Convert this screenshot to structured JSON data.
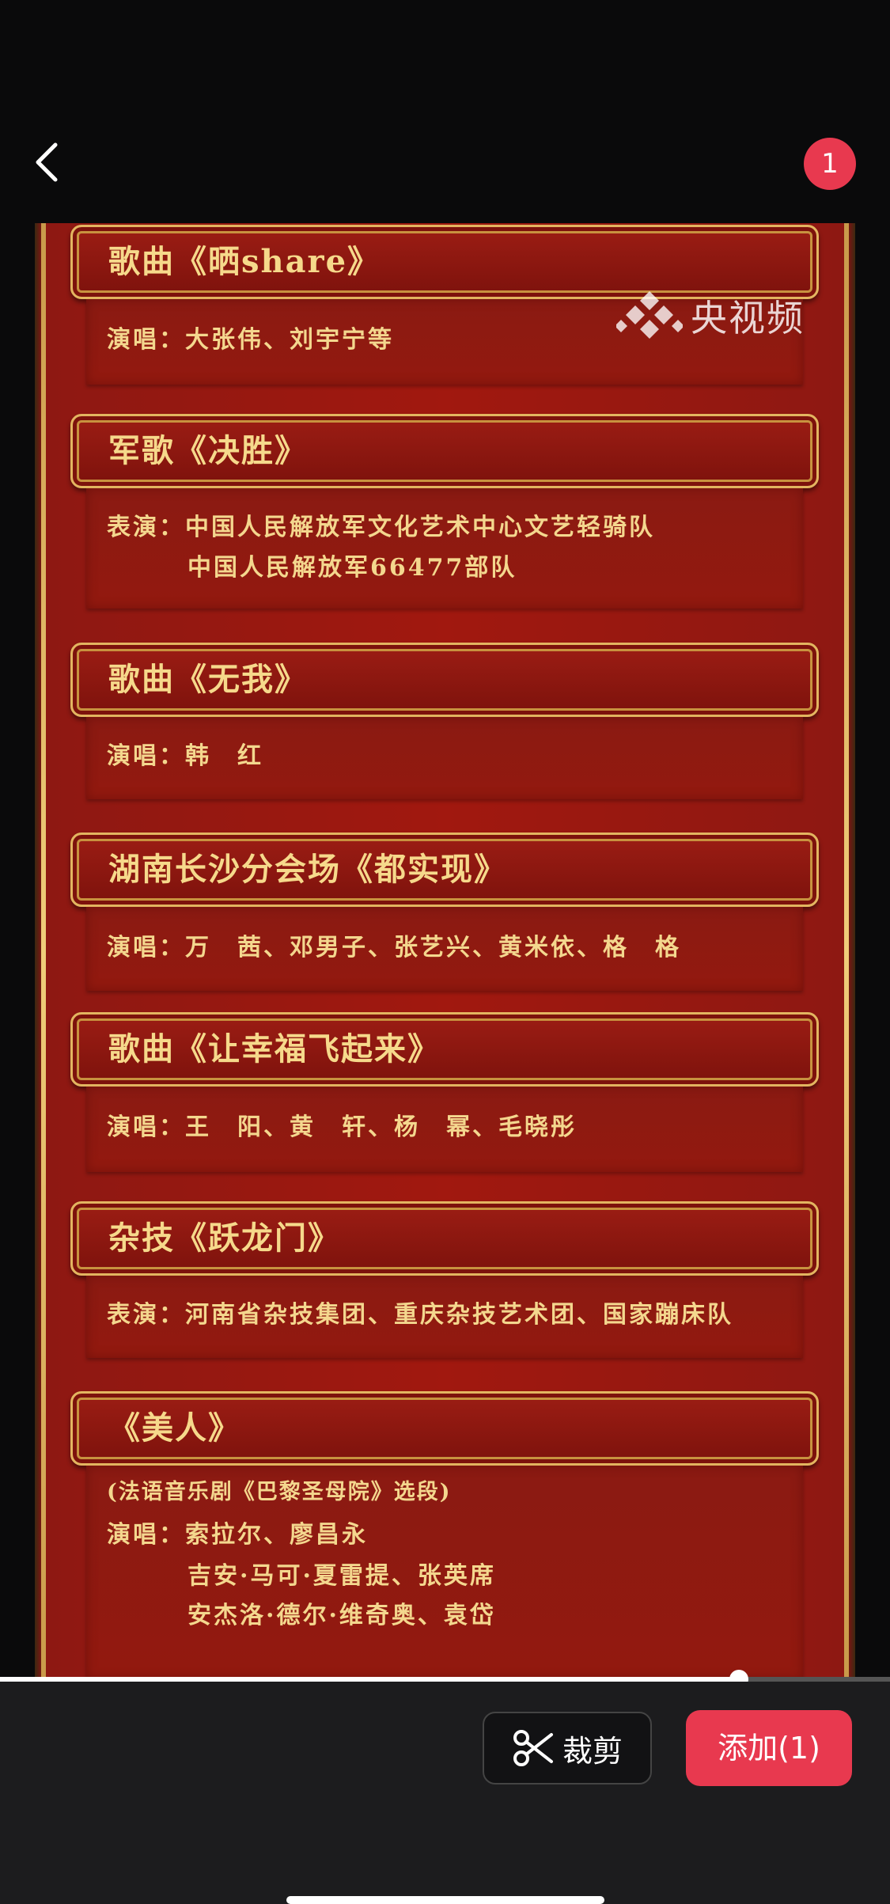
{
  "header": {
    "back_icon": "chevron-left-icon",
    "selection_count": "1"
  },
  "poster": {
    "watermark": "央视频",
    "sections": [
      {
        "title": "歌曲《晒share》",
        "lines": [
          "演唱：大张伟、刘宇宁等"
        ]
      },
      {
        "title": "军歌《决胜》",
        "lines": [
          "表演：中国人民解放军文化艺术中心文艺轻骑队",
          "中国人民解放军66477部队"
        ]
      },
      {
        "title": "歌曲《无我》",
        "lines": [
          "演唱：韩　红"
        ]
      },
      {
        "title": "湖南长沙分会场《都实现》",
        "lines": [
          "演唱：万　茜、邓男子、张艺兴、黄米依、格　格"
        ]
      },
      {
        "title": "歌曲《让幸福飞起来》",
        "lines": [
          "演唱：王　阳、黄　轩、杨　幂、毛晓彤"
        ]
      },
      {
        "title": "杂技《跃龙门》",
        "lines": [
          "表演：河南省杂技集团、重庆杂技艺术团、国家蹦床队"
        ]
      },
      {
        "title": "《美人》",
        "lines": [
          "(法语音乐剧《巴黎圣母院》选段)",
          "演唱：索拉尔、廖昌永",
          "吉安·马可·夏雷提、张英席",
          "安杰洛·德尔·维奇奥、袁岱"
        ]
      }
    ]
  },
  "progress": {
    "value_percent": 83
  },
  "toolbar": {
    "crop_label": "裁剪",
    "crop_icon": "scissors-icon",
    "add_label": "添加(1)"
  },
  "colors": {
    "accent": "#e8394f",
    "poster_red": "#a1180f",
    "gold_text": "#f6d98b"
  }
}
